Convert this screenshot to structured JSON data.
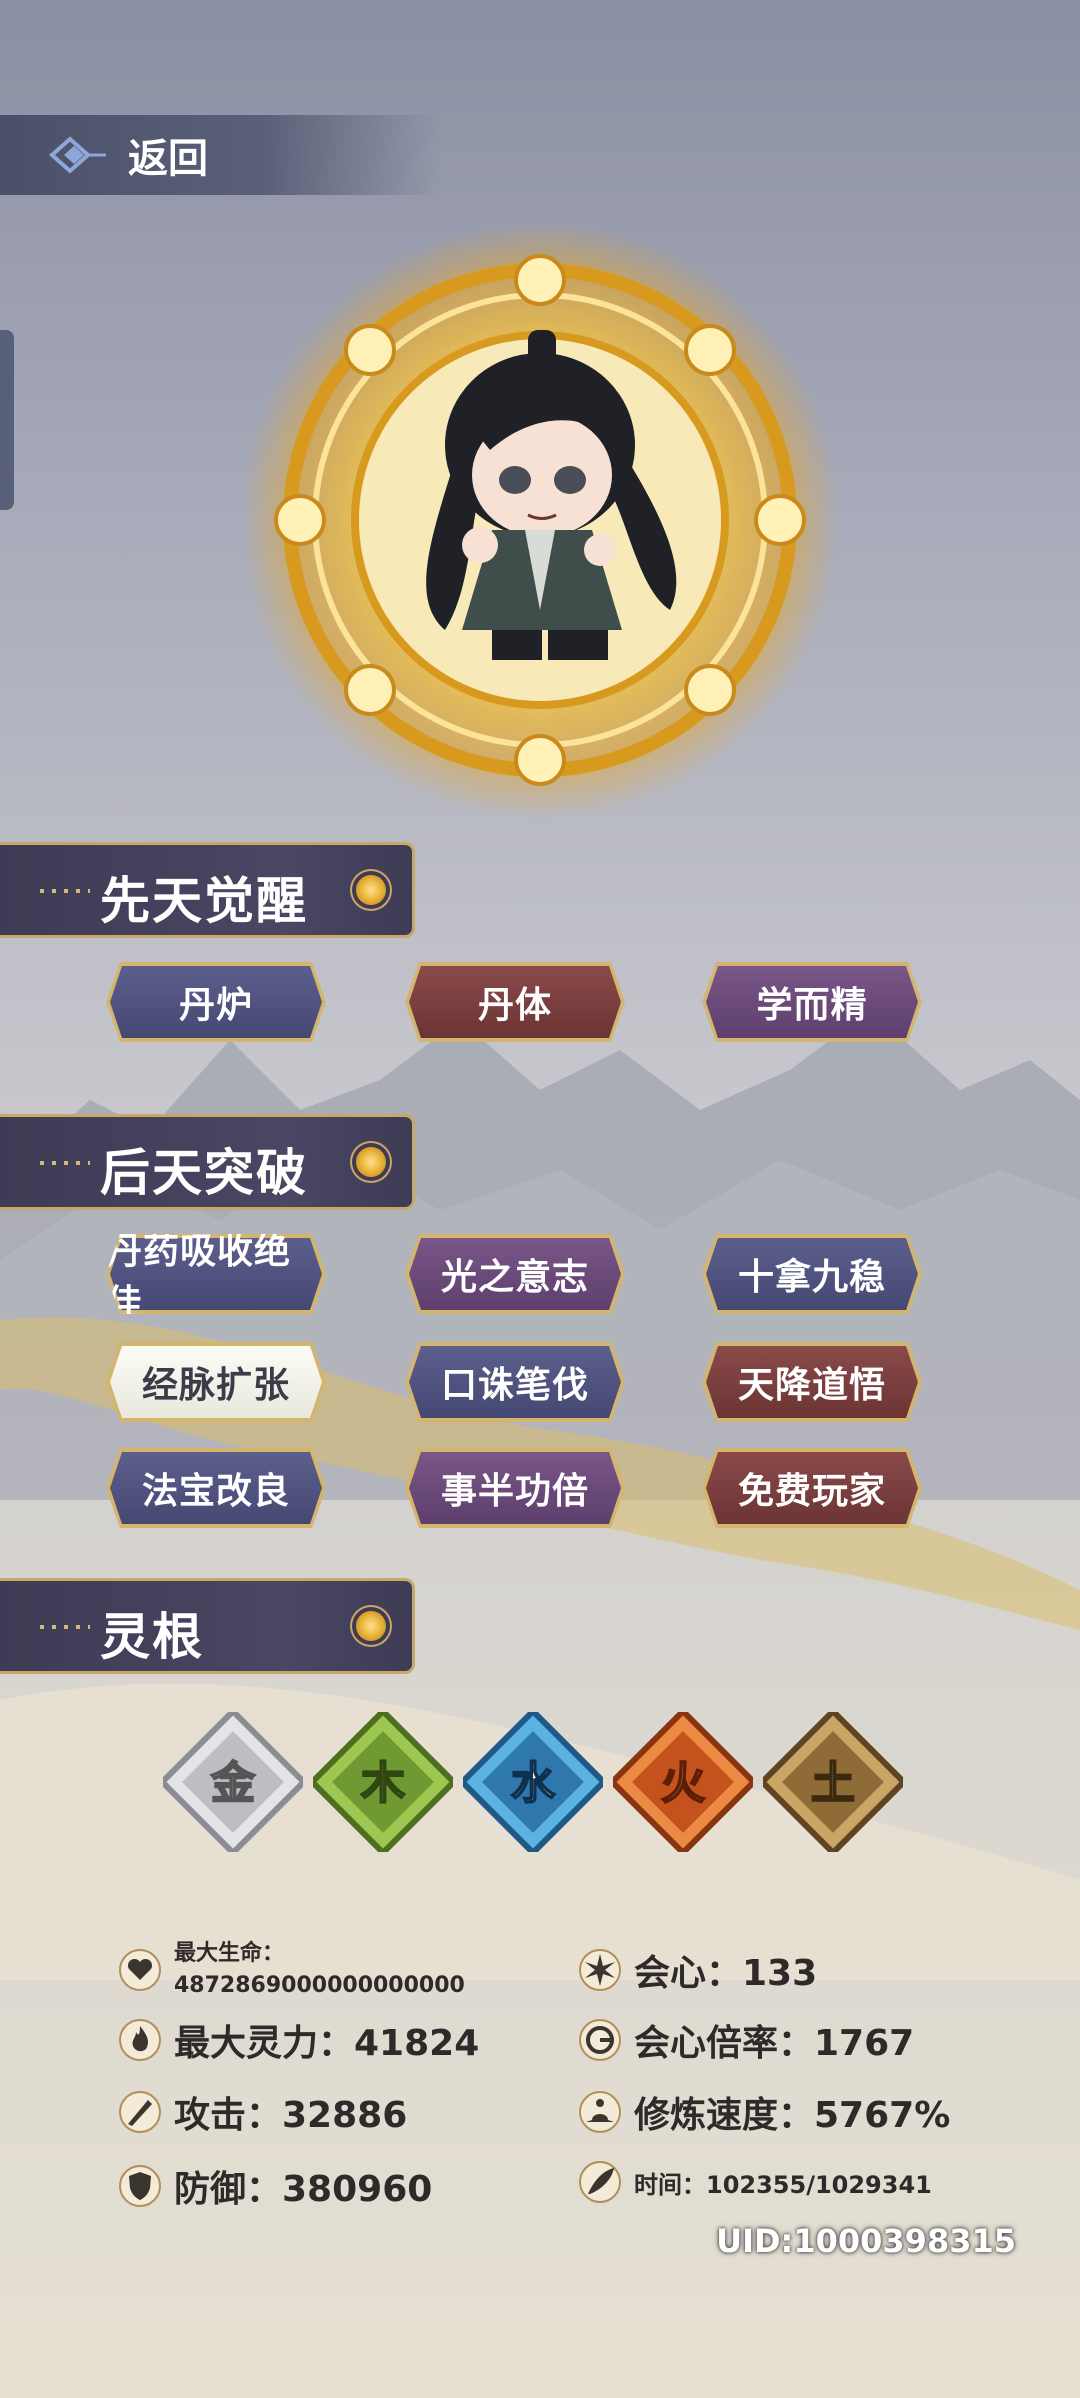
{
  "header": {
    "back_label": "返回"
  },
  "sections": {
    "innate": "先天觉醒",
    "acquired": "后天突破",
    "roots": "灵根"
  },
  "innate_tags": [
    {
      "label": "丹炉",
      "style": "blue"
    },
    {
      "label": "丹体",
      "style": "red"
    },
    {
      "label": "学而精",
      "style": "purple"
    }
  ],
  "acquired_tags": [
    {
      "label": "丹药吸收绝佳",
      "style": "blue"
    },
    {
      "label": "光之意志",
      "style": "purple"
    },
    {
      "label": "十拿九稳",
      "style": "blue"
    },
    {
      "label": "经脉扩张",
      "style": "white"
    },
    {
      "label": "口诛笔伐",
      "style": "blue"
    },
    {
      "label": "天降道悟",
      "style": "red"
    },
    {
      "label": "法宝改良",
      "style": "blue"
    },
    {
      "label": "事半功倍",
      "style": "purple"
    },
    {
      "label": "免费玩家",
      "style": "red"
    }
  ],
  "roots": [
    {
      "char": "金",
      "color": "#cfcfd4"
    },
    {
      "char": "木",
      "color": "#7aa83c"
    },
    {
      "char": "水",
      "color": "#3f8fc4"
    },
    {
      "char": "火",
      "color": "#d8692a"
    },
    {
      "char": "土",
      "color": "#b08a4c"
    }
  ],
  "stats": {
    "max_hp_label": "最大生命：",
    "max_hp_value": "4872869000000000000",
    "max_mana": "最大灵力：41824",
    "attack": "攻击：32886",
    "defense": "防御：380960",
    "crit": "会心：133",
    "crit_mult": "会心倍率：1767",
    "cultivation_speed": "修炼速度：5767%",
    "time": "时间：102355/1029341"
  },
  "uid": "UID:1000398315",
  "icons": {
    "back": "back-arrow-icon",
    "heart": "heart-icon",
    "flame": "flame-icon",
    "sword": "brush-sword-icon",
    "shield": "shield-icon",
    "star": "burst-icon",
    "crit_mult": "crescent-icon",
    "meditate": "meditate-icon",
    "feather": "feather-icon"
  }
}
